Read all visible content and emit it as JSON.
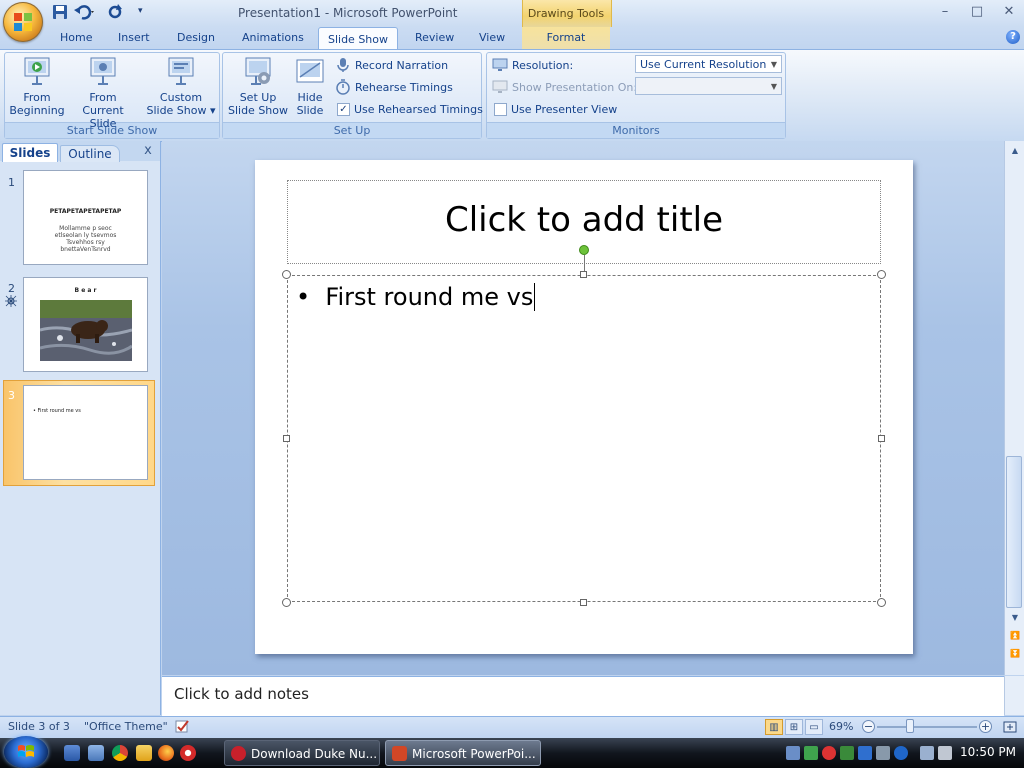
{
  "window": {
    "title": "Presentation1 - Microsoft PowerPoint",
    "contextual_group": "Drawing Tools",
    "minimize": "–",
    "maximize": "□",
    "close": "✕"
  },
  "tabs": [
    {
      "label": "Home"
    },
    {
      "label": "Insert"
    },
    {
      "label": "Design"
    },
    {
      "label": "Animations"
    },
    {
      "label": "Slide Show",
      "active": true
    },
    {
      "label": "Review"
    },
    {
      "label": "View"
    },
    {
      "label": "Format",
      "contextual": true
    }
  ],
  "help": "?",
  "ribbon": {
    "start_group": {
      "label": "Start Slide Show",
      "from_beginning": [
        "From",
        "Beginning"
      ],
      "from_current": [
        "From",
        "Current Slide"
      ],
      "custom": [
        "Custom",
        "Slide Show ▾"
      ]
    },
    "setup_group": {
      "label": "Set Up",
      "setup_show": [
        "Set Up",
        "Slide Show"
      ],
      "hide_slide": [
        "Hide",
        "Slide"
      ],
      "record_narration": "Record Narration",
      "rehearse_timings": "Rehearse Timings",
      "use_rehearsed": "Use Rehearsed Timings",
      "use_rehearsed_checked": true
    },
    "monitors_group": {
      "label": "Monitors",
      "resolution_label": "Resolution:",
      "resolution_value": "Use Current Resolution",
      "show_on_label": "Show Presentation On:",
      "show_on_value": "",
      "presenter_view": "Use Presenter View",
      "presenter_view_checked": false
    }
  },
  "pane": {
    "tab_slides": "Slides",
    "tab_outline": "Outline",
    "close": "x",
    "slides": [
      {
        "number": "1",
        "title": "PETAPETAPETAPETAP",
        "body": "Mollamme p seoc etlseolan ly tsevmos Tsvehhos rsy bnettaVenTsnrvd"
      },
      {
        "number": "2",
        "title": "B e a r",
        "has_transition_icon": true
      },
      {
        "number": "3",
        "body": "First round me vs",
        "selected": true
      }
    ]
  },
  "slide": {
    "title_placeholder": "Click to add title",
    "bullet": "•",
    "body_text": "First round me vs"
  },
  "notes": {
    "placeholder": "Click to add notes"
  },
  "statusbar": {
    "slide_info": "Slide 3 of 3",
    "theme": "\"Office Theme\"",
    "zoom": "69%",
    "zoom_percent": 69
  },
  "taskbar": {
    "tasks": [
      {
        "label": "Download Duke Nu...",
        "icon_color": "#c8202b"
      },
      {
        "label": "Microsoft PowerPoi...",
        "icon_color": "#d24726",
        "active": true
      }
    ],
    "clock": "10:50 PM"
  },
  "colors": {
    "accent": "#15428b",
    "active_thumb": "#f9c46a",
    "rotate_handle": "#6dc23a"
  }
}
